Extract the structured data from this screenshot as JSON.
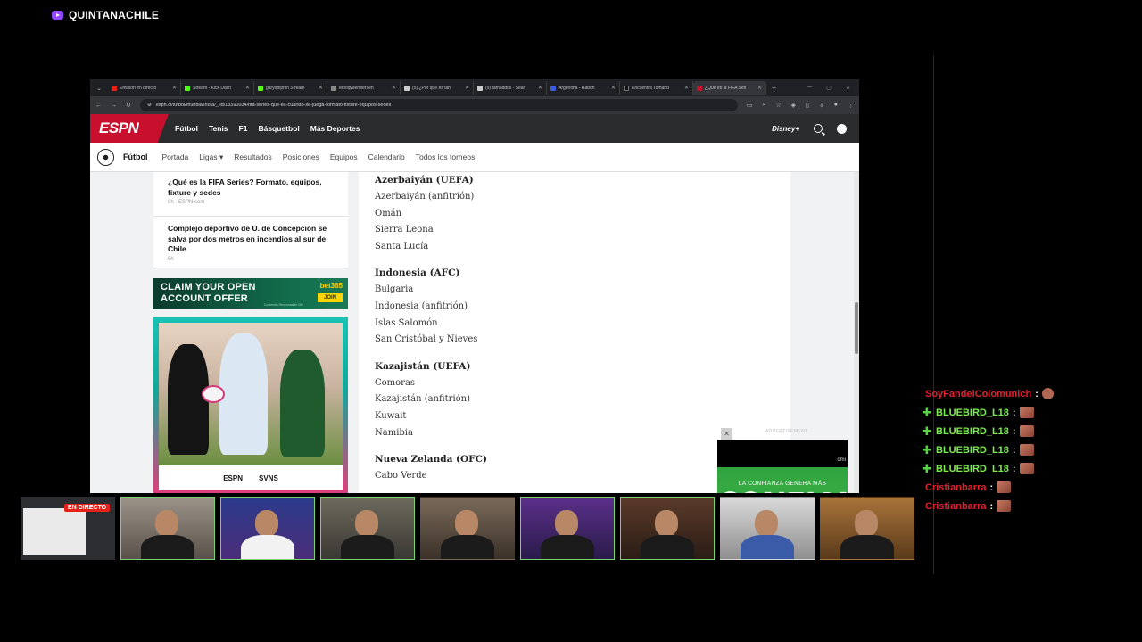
{
  "channel": {
    "name": "QUINTANACHILE",
    "icon": "twitch-icon"
  },
  "browser": {
    "tabs": [
      {
        "title": "Emisión en directo",
        "color": "#e62117"
      },
      {
        "title": "Stream - Kick Dash",
        "color": "#53fc18"
      },
      {
        "title": "garydolphin Stream",
        "color": "#53fc18"
      },
      {
        "title": "Mooqwtermeri en",
        "color": "#888888"
      },
      {
        "title": "(5) ¿Por qué es tan",
        "color": "#cccccc"
      },
      {
        "title": "(9) tamaddoll · Sear",
        "color": "#cccccc"
      },
      {
        "title": "Argentina - Rabon",
        "color": "#3b5bdb"
      },
      {
        "title": "Encuentra Tomand",
        "color": "#111111"
      },
      {
        "title": "¿Qué es la FIFA Seri",
        "color": "#c8102e"
      }
    ],
    "url": "espn.cl/futbol/mundial/nota/_/id/13390034/fifa-series-que-es-cuando-se-juega-formato-fixture-equipos-sedes"
  },
  "espn": {
    "logo": "ESPN",
    "nav": [
      "Fútbol",
      "Tenis",
      "F1",
      "Básquetbol",
      "Más Deportes"
    ],
    "disney": "Disney+",
    "subnav": {
      "sport": "Fútbol",
      "links": [
        "Portada",
        "Ligas ▾",
        "Resultados",
        "Posiciones",
        "Equipos",
        "Calendario",
        "Todos los torneos"
      ]
    }
  },
  "sidebar": {
    "cards": [
      {
        "title": "¿Qué es la FIFA Series? Formato, equipos, fixture y sedes",
        "meta": "8h · ESPN.com"
      },
      {
        "title": "Complejo deportivo de U. de Concepción se salva por dos metros en incendios al sur de Chile",
        "meta": "5h"
      }
    ],
    "bet_ad": {
      "line1": "CLAIM YOUR OPEN",
      "line2": "ACCOUNT OFFER",
      "brand": "bet365",
      "join": "JOIN",
      "small": "Contenido Responsable 18+"
    },
    "rugby_ad": {
      "brand1": "ESPN",
      "brand2": "SVNS"
    }
  },
  "article": {
    "groups": [
      {
        "title": "Azerbaiyán (UEFA)",
        "teams": [
          "Azerbaiyán (anfitrión)",
          "Omán",
          "Sierra Leona",
          "Santa Lucía"
        ]
      },
      {
        "title": "Indonesia (AFC)",
        "teams": [
          "Bulgaria",
          "Indonesia (anfitrión)",
          "Islas Salomón",
          "San Cristóbal y Nieves"
        ]
      },
      {
        "title": "Kazajistán (UEFA)",
        "teams": [
          "Comoras",
          "Kazajistán (anfitrión)",
          "Kuwait",
          "Namibia"
        ]
      },
      {
        "title": "Nueva Zelanda (OFC)",
        "teams": [
          "Cabo Verde"
        ]
      }
    ]
  },
  "video_ad": {
    "label": "ADVERTISEMENT",
    "close": "✕",
    "brand": "omi",
    "line1": "LA CONFIANZA GENERA MÁS",
    "line2": "CONFIANZA"
  },
  "cams": {
    "live": "EN DIRECTO"
  },
  "chat": [
    {
      "user": "SoyFandelColomunich",
      "color": "red",
      "sub": false
    },
    {
      "user": "BLUEBIRD_L18",
      "color": "green",
      "sub": true
    },
    {
      "user": "BLUEBIRD_L18",
      "color": "green",
      "sub": true
    },
    {
      "user": "BLUEBIRD_L18",
      "color": "green",
      "sub": true
    },
    {
      "user": "BLUEBIRD_L18",
      "color": "green",
      "sub": true
    },
    {
      "user": "Cristianbarra",
      "color": "red",
      "sub": false
    },
    {
      "user": "Cristianbarra",
      "color": "red",
      "sub": false
    }
  ]
}
